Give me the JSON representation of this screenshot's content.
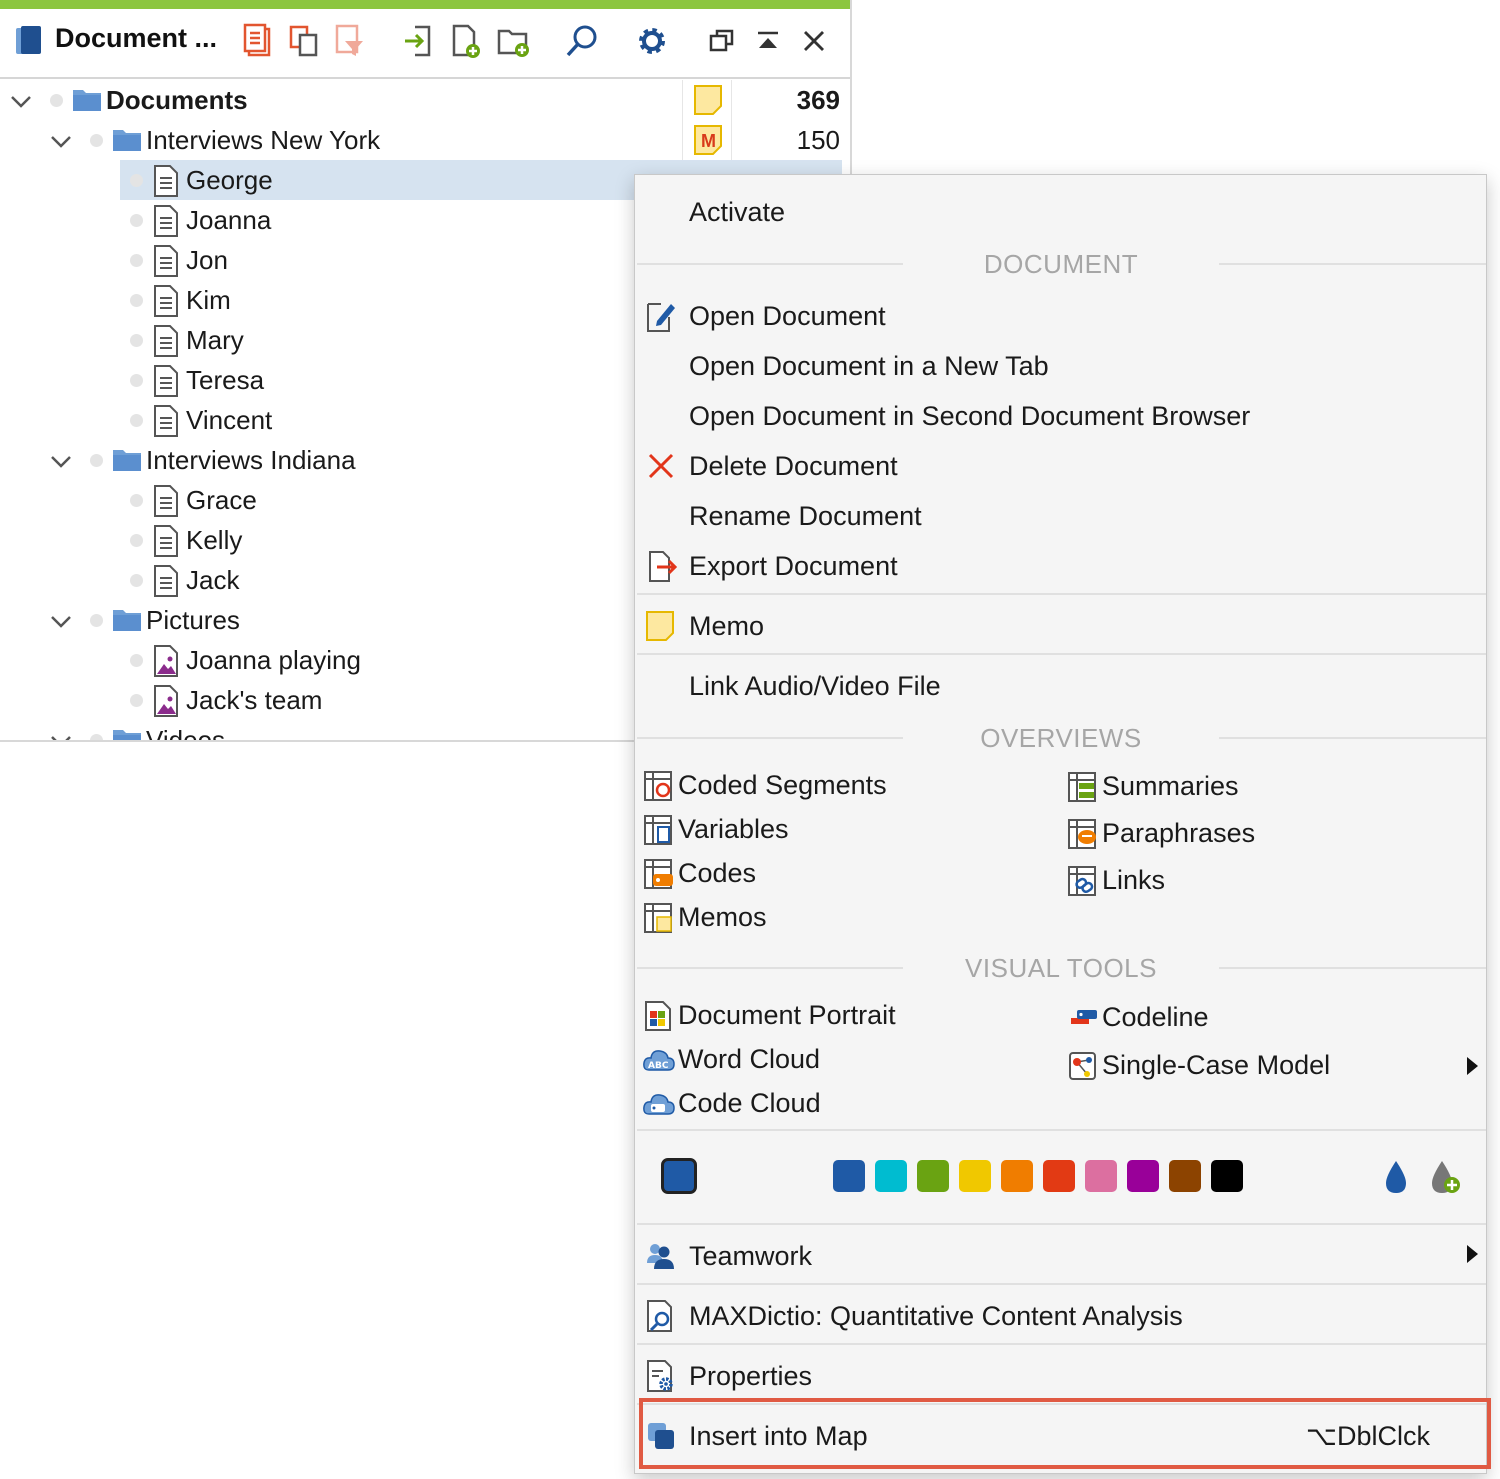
{
  "panel": {
    "title": "Document ...",
    "accent_color": "#8cc63f",
    "toolbar_icons": [
      "documents-app-icon",
      "activate-all-icon",
      "copy-documents-icon",
      "filter-icon",
      "import-icon",
      "new-document-icon",
      "new-folder-icon",
      "search-icon",
      "settings-gear-icon",
      "float-window-icon",
      "maximize-icon",
      "close-icon"
    ]
  },
  "tree": {
    "root": {
      "label": "Documents",
      "count": "369"
    },
    "groups": [
      {
        "label": "Interviews New York",
        "count": "150",
        "docs": [
          "George",
          "Joanna",
          "Jon",
          "Kim",
          "Mary",
          "Teresa",
          "Vincent"
        ]
      },
      {
        "label": "Interviews Indiana",
        "docs": [
          "Grace",
          "Kelly",
          "Jack"
        ]
      },
      {
        "label": "Pictures",
        "docs": [
          "Joanna playing",
          "Jack's team"
        ]
      },
      {
        "label": "Videos"
      }
    ],
    "selected": "George"
  },
  "menu": {
    "activate": "Activate",
    "section_document": "DOCUMENT",
    "open_document": "Open Document",
    "open_new_tab": "Open Document in a New Tab",
    "open_second_browser": "Open Document in Second Document Browser",
    "delete_document": "Delete Document",
    "rename_document": "Rename Document",
    "export_document": "Export Document",
    "memo": "Memo",
    "link_av": "Link Audio/Video File",
    "section_overviews": "OVERVIEWS",
    "overviews_left": [
      "Coded Segments",
      "Variables",
      "Codes",
      "Memos"
    ],
    "overviews_right": [
      "Summaries",
      "Paraphrases",
      "Links"
    ],
    "section_visual": "VISUAL TOOLS",
    "visual_left": [
      "Document Portrait",
      "Word Cloud",
      "Code Cloud"
    ],
    "visual_right": [
      "Codeline",
      "Single-Case Model"
    ],
    "colors": {
      "current": "#1f5aa6",
      "palette": [
        "#1f5aa6",
        "#00bcd0",
        "#6aa312",
        "#f0c800",
        "#f07d00",
        "#e23a14",
        "#dc6fa0",
        "#990099",
        "#8c4300",
        "#000000"
      ]
    },
    "teamwork": "Teamwork",
    "maxdictio": "MAXDictio: Quantitative Content Analysis",
    "properties": "Properties",
    "insert_map": "Insert into Map",
    "insert_map_shortcut": "⌥DblClck",
    "highlight_color": "#e05a43"
  }
}
